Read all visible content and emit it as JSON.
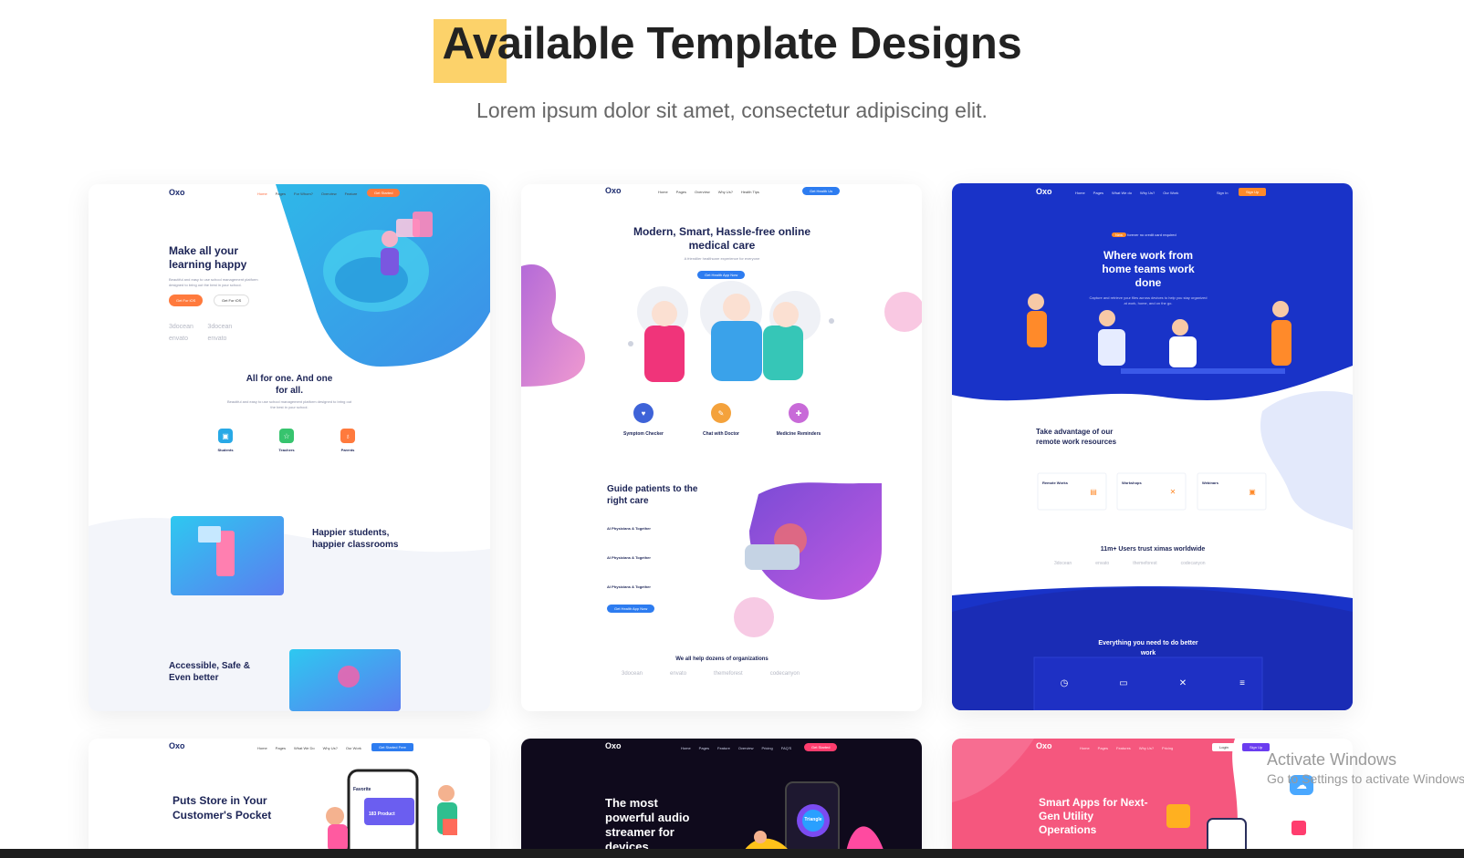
{
  "header": {
    "title_highlight": "Av",
    "title_rest": "ailable Template Designs",
    "subtitle": "Lorem ipsum dolor sit amet, consectetur adipiscing elit."
  },
  "cards": [
    {
      "logo": "Oxo",
      "nav": [
        "Home",
        "Pages",
        "For Whom?",
        "Overview",
        "Feature"
      ],
      "cta": "Get Started",
      "hero": "Make all your learning happy",
      "hero_para": "Beautiful and easy to use school management platform designed to bring out the best in your school.",
      "btn1": "Get For iOS",
      "btn2": "Get For iOS",
      "brands": [
        "3docean",
        "3docean",
        "envato",
        "envato"
      ],
      "section2": "All for one. And one for all.",
      "section2_para": "Beautiful and easy to use school management platform designed to bring out the best in your school.",
      "features": [
        "Students",
        "Teachers",
        "Parents"
      ],
      "section3": "Happier students, happier classrooms",
      "section4": "Accessible, Safe & Even better"
    },
    {
      "logo": "Oxo",
      "nav": [
        "Home",
        "Pages",
        "Overview",
        "Why Us?",
        "Health Tips"
      ],
      "cta": "Get Health Us",
      "hero": "Modern, Smart, Hassle-free online medical care",
      "hero_para": "A friendlier healthcare experience for everyone",
      "hero_btn": "Get Health App Now",
      "features": [
        "Symptom Checker",
        "Chat with Doctor",
        "Medicine Reminders"
      ],
      "section2": "Guide patients to the right care",
      "list": [
        "AI Physicians & Together",
        "AI Physicians & Together",
        "AI Physicians & Together"
      ],
      "section2_btn": "Get Health App Now",
      "footer": "We all help dozens of organizations",
      "brands": [
        "3docean",
        "envato",
        "themeforest",
        "codecanyon"
      ]
    },
    {
      "logo": "Oxo",
      "nav": [
        "Home",
        "Pages",
        "What We do",
        "Why Us?",
        "Our Work"
      ],
      "signin": "Sign In",
      "cta": "Sign Up",
      "badge_tag": "New",
      "badge": "forever no credit card required",
      "hero": "Where work from home teams work done",
      "hero_para": "Capture and retrieve your files across devices to help you stay organized at work, home, and on the go.",
      "section2": "Take advantage of our remote work resources",
      "resources": [
        "Remote Works",
        "Workshops",
        "Webinars"
      ],
      "trust": "11m+ Users trust ximas worldwide",
      "brands": [
        "3docean",
        "envato",
        "themeforest",
        "codecanyon"
      ],
      "footer": "Everything you need to do better work"
    },
    {
      "logo": "Oxo",
      "nav": [
        "Home",
        "Pages",
        "What We Do",
        "Why Us?",
        "Our Work"
      ],
      "cta": "Get Started Free",
      "hero": "Puts Store in Your Customer's Pocket",
      "phone_title": "Favorite",
      "phone_card": "183 Product"
    },
    {
      "logo": "Oxo",
      "nav": [
        "Home",
        "Pages",
        "Feature",
        "Overview",
        "Pricing",
        "FAQ'S"
      ],
      "cta": "Get Started",
      "hero": "The most powerful audio streamer for devices",
      "phone_label": "Triangle"
    },
    {
      "logo": "Oxo",
      "nav": [
        "Home",
        "Pages",
        "Features",
        "Why Us?",
        "Pricing"
      ],
      "login": "Login",
      "cta": "Sign Up",
      "hero": "Smart Apps for Next-Gen Utility Operations"
    }
  ],
  "watermark": {
    "line1": "Activate Windows",
    "line2": "Go to Settings to activate Windows."
  }
}
